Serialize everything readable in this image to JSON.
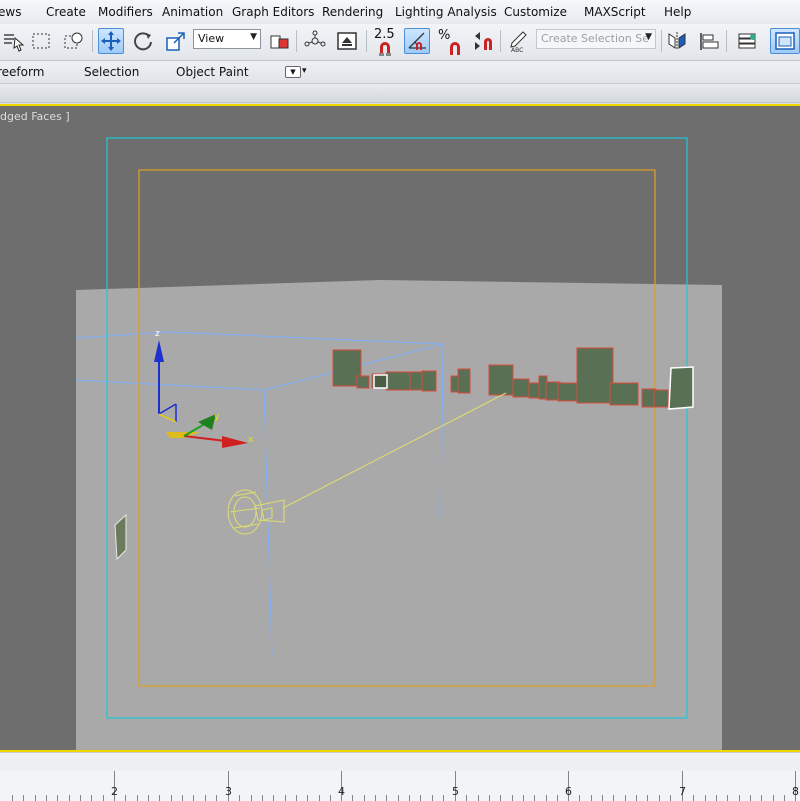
{
  "menu": {
    "items": [
      "ews",
      "Create",
      "Modifiers",
      "Animation",
      "Graph Editors",
      "Rendering",
      "Lighting Analysis",
      "Customize",
      "MAXScript",
      "Help"
    ]
  },
  "toolbar": {
    "reference_coord": "View",
    "angle_snap": "2.5",
    "percent_snap": "%",
    "named_selection_placeholder": "Create Selection Se",
    "icons": [
      "select-by-name-icon",
      "rectangular-selection-icon",
      "window-crossing-icon",
      "select-and-move-icon",
      "select-and-rotate-icon",
      "select-and-scale-icon",
      "use-pivot-center-icon",
      "select-and-manipulate-icon",
      "keyboard-shortcut-override-icon",
      "angle-snap-icon",
      "percent-snap-icon",
      "spinner-snap-icon",
      "edit-named-selection-icon",
      "mirror-icon",
      "align-icon",
      "layer-manager-icon",
      "graphite-toggle-icon"
    ],
    "active_tool": "select-and-move"
  },
  "ribbon": {
    "tabs": [
      "reeform",
      "Selection",
      "Object Paint"
    ]
  },
  "viewport": {
    "label": "dged Faces ]",
    "colors": {
      "background": "#6e6e6e",
      "ground": "#a9a9a9",
      "safe_frame_outer": "#22c7d6",
      "safe_frame_inner": "#e0a020",
      "grid": "#7fb0ff",
      "buildings_fill": "#5a7054",
      "buildings_outline": "#d94a3a",
      "camera": "#dede70",
      "active_border": "#f2d600"
    },
    "axis_labels": {
      "z": "z",
      "y": "y",
      "x": "x"
    }
  },
  "timeline": {
    "ticks": [
      "2",
      "3",
      "4",
      "5",
      "6",
      "7",
      "8"
    ]
  }
}
